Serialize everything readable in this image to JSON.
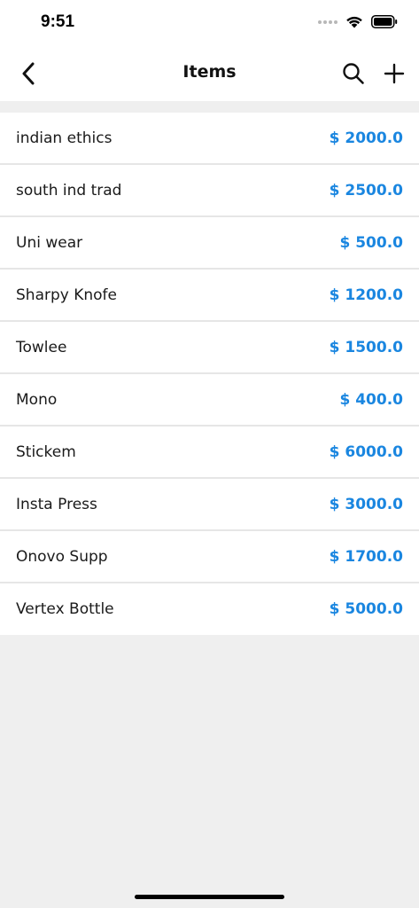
{
  "status_bar": {
    "time": "9:51"
  },
  "nav": {
    "title": "Items"
  },
  "colors": {
    "price": "#1a86e0",
    "background": "#efefef",
    "surface": "#ffffff"
  },
  "icons": {
    "back": "chevron-left-icon",
    "search": "search-icon",
    "add": "plus-icon"
  },
  "items": [
    {
      "name": "indian ethics",
      "price": "$ 2000.0"
    },
    {
      "name": "south ind trad",
      "price": "$ 2500.0"
    },
    {
      "name": "Uni wear",
      "price": "$ 500.0"
    },
    {
      "name": "Sharpy Knofe",
      "price": "$ 1200.0"
    },
    {
      "name": "Towlee",
      "price": "$ 1500.0"
    },
    {
      "name": "Mono",
      "price": "$ 400.0"
    },
    {
      "name": "Stickem",
      "price": "$ 6000.0"
    },
    {
      "name": "Insta Press",
      "price": "$ 3000.0"
    },
    {
      "name": "Onovo Supp",
      "price": "$ 1700.0"
    },
    {
      "name": "Vertex Bottle",
      "price": "$ 5000.0"
    }
  ]
}
